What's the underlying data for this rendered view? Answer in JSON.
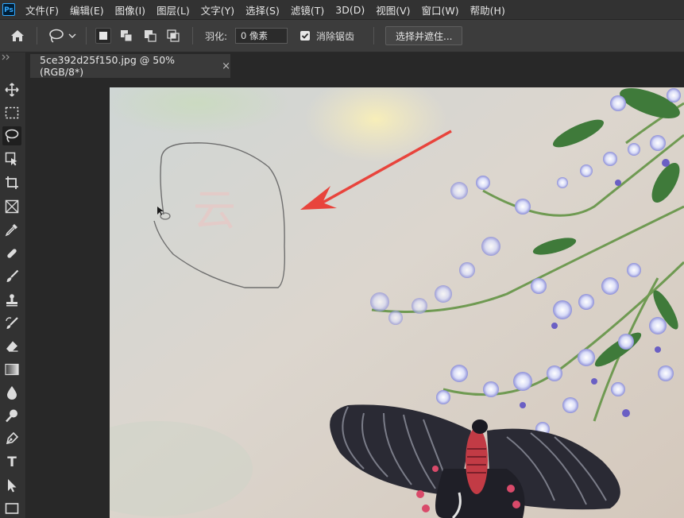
{
  "app": {
    "logo": "Ps"
  },
  "menu": [
    "文件(F)",
    "编辑(E)",
    "图像(I)",
    "图层(L)",
    "文字(Y)",
    "选择(S)",
    "滤镜(T)",
    "3D(D)",
    "视图(V)",
    "窗口(W)",
    "帮助(H)"
  ],
  "options": {
    "feather_label": "羽化:",
    "feather_value": "0 像素",
    "antialias_label": "消除锯齿",
    "antialias_checked": true,
    "select_mask_label": "选择并遮住..."
  },
  "document": {
    "tab_title": "5ce392d25f150.jpg @ 50%(RGB/8*)",
    "close_glyph": "×"
  },
  "canvas": {
    "text": "云"
  },
  "tools": [
    "move-icon",
    "marquee-icon",
    "lasso-icon",
    "object-select-icon",
    "crop-icon",
    "frame-icon",
    "eyedropper-icon",
    "healing-brush-icon",
    "brush-icon",
    "stamp-icon",
    "history-brush-icon",
    "eraser-icon",
    "gradient-icon",
    "blur-icon",
    "dodge-icon",
    "pen-icon",
    "type-icon",
    "path-select-icon",
    "shape-icon"
  ],
  "tool_type_glyph": "T",
  "colors": {
    "accent": "#31a8ff",
    "arrow": "#e8443c",
    "lasso": "#6e6e6e"
  }
}
